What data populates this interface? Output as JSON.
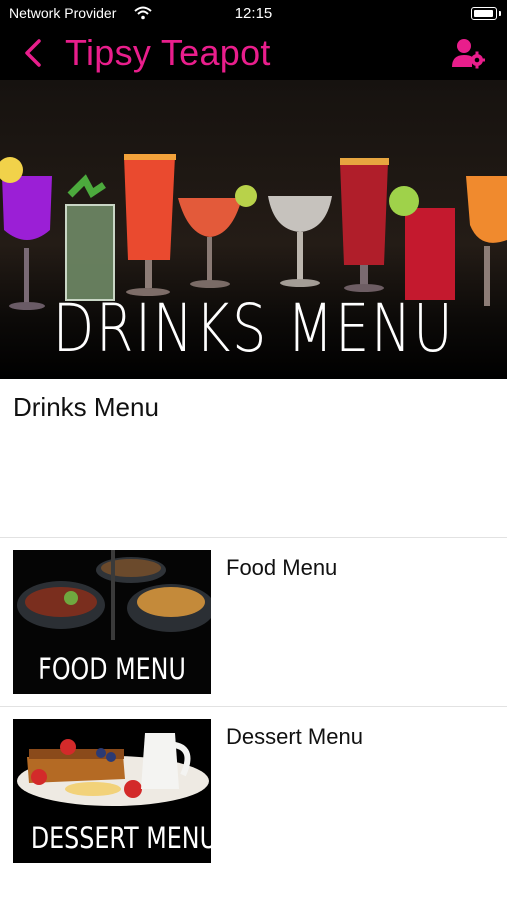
{
  "status_bar": {
    "carrier": "Network Provider",
    "time": "12:15"
  },
  "nav": {
    "title": "Tipsy Teapot",
    "back_icon": "chevron-left-icon",
    "action_icon": "user-settings-icon"
  },
  "hero": {
    "caption": "DRINKS MENU"
  },
  "section": {
    "title": "Drinks Menu"
  },
  "menu_items": [
    {
      "label": "Food Menu",
      "thumb_caption": "FOOD MENU"
    },
    {
      "label": "Dessert Menu",
      "thumb_caption": "DESSERT MENU"
    }
  ],
  "colors": {
    "accent": "#e91e8c",
    "header_bg": "#000000"
  }
}
